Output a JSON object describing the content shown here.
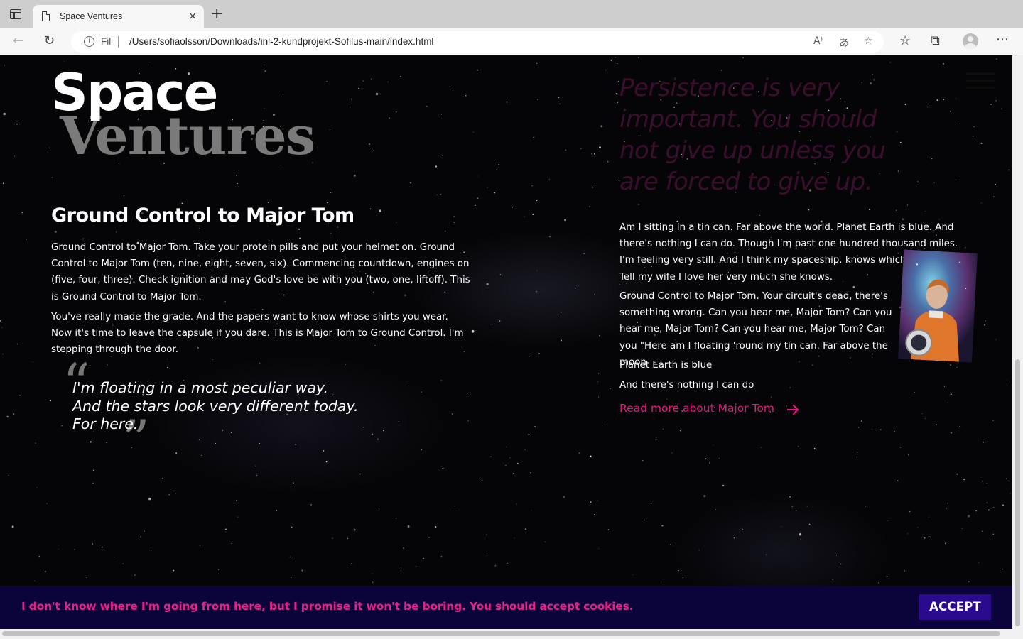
{
  "browser": {
    "tab_title": "Space Ventures",
    "tab_close": "×",
    "new_tab": "+",
    "address_prefix": "Fil",
    "url": "/Users/sofiaolsson/Downloads/inl-2-kundprojekt-Sofilus-main/index.html",
    "toolbar_icons": [
      "back-icon",
      "reload-icon",
      "read-aloud-icon",
      "translate-icon",
      "favorite-add-icon",
      "favorites-icon",
      "collections-icon",
      "profile-avatar",
      "more-icon"
    ]
  },
  "site": {
    "logo_top": "Space",
    "logo_bottom": "Ventures",
    "pull_quote": "Persistence is very important. You should not give up unless you are forced to give up.",
    "left": {
      "title": "Ground Control to Major Tom",
      "paragraphs": [
        "Ground Control to Major Tom. Take your protein pills and put your helmet on. Ground Control to Major Tom (ten, nine, eight, seven, six). Commencing countdown, engines on (five, four, three). Check ignition and may God's love be with you (two, one, liftoff). This is Ground Control to Major Tom.",
        "You've really made the grade. And the papers want to know whose shirts you wear. Now it's time to leave the capsule if you dare. This is Major Tom to Ground Control. I'm stepping through the door."
      ],
      "quote_lines": [
        "I'm floating in a most peculiar way.",
        "And the stars look very different today.",
        "For here."
      ],
      "quote_open": "“",
      "quote_close": "”"
    },
    "right": {
      "paragraphs": [
        "Am I sitting in a tin can. Far above the world. Planet Earth is blue. And there's nothing I can do. Though I'm past one hundred thousand miles. I'm feeling very still. And I think my spaceship. knows which way to go. Tell my wife I love her very much she knows.",
        "Ground Control to Major Tom. Your circuit's dead, there's something wrong. Can you hear me, Major Tom? Can you hear me, Major Tom? Can you hear me, Major Tom? Can you \"Here am I floating 'round my tin can. Far above the moon",
        "Planet Earth is blue",
        "And there's nothing I can do"
      ],
      "read_more": "Read more about Major Tom"
    },
    "cookie": {
      "text": "I don't know where I'm going from here, but I promise it won't be boring. You should accept cookies.",
      "accept": "ACCEPT"
    },
    "colors": {
      "accent_pink": "#e4167f",
      "cookie_bg": "#0b043a",
      "accept_bg": "#2b0b8d",
      "pull_quote": "#3a0f2e",
      "logo_secondary": "#7a7a7a"
    }
  }
}
